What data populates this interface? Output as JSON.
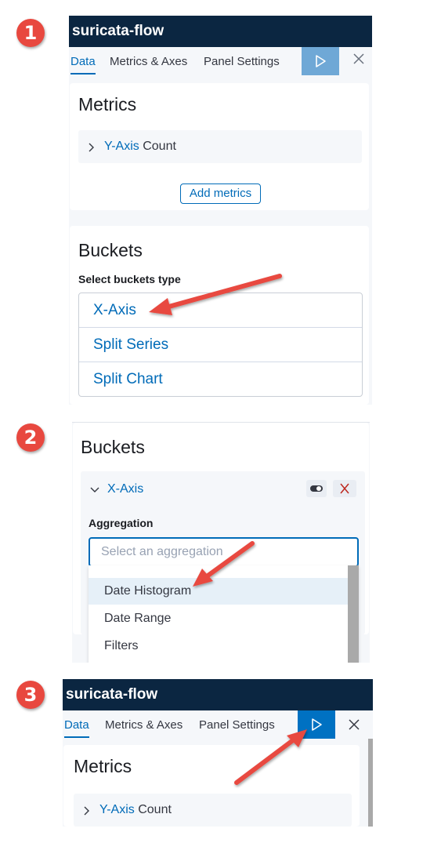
{
  "steps": [
    "1",
    "2",
    "3"
  ],
  "app": {
    "title": "suricata-flow"
  },
  "tabs": {
    "data": "Data",
    "metrics_axes": "Metrics & Axes",
    "panel_settings": "Panel Settings"
  },
  "metrics": {
    "heading": "Metrics",
    "y_axis_label": "Y-Axis",
    "y_axis_value": "Count",
    "add_button": "Add metrics"
  },
  "buckets": {
    "heading": "Buckets",
    "select_label": "Select buckets type",
    "types": [
      "X-Axis",
      "Split Series",
      "Split Chart"
    ]
  },
  "aggregation": {
    "x_axis_label": "X-Axis",
    "label": "Aggregation",
    "placeholder": "Select an aggregation",
    "options": [
      "Date Histogram",
      "Date Range",
      "Filters"
    ]
  },
  "icons": {
    "run": "play-icon",
    "close": "close-icon",
    "chevron_right": "chevron-right-icon",
    "chevron_down": "chevron-down-icon",
    "toggle": "toggle-icon",
    "remove": "remove-x-icon"
  },
  "colors": {
    "titlebar": "#0b2641",
    "accent": "#006bb8",
    "run_disabled": "#6fa8d6",
    "run_active": "#0071c2",
    "annotation_red": "#e8483f"
  }
}
